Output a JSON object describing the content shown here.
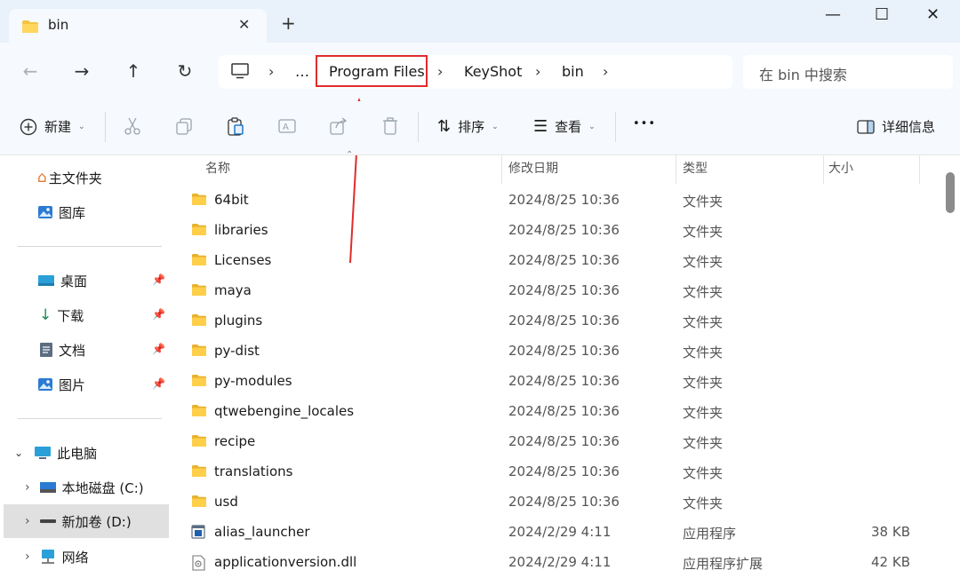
{
  "tab": {
    "title": "bin",
    "close_glyph": "✕",
    "new_tab_glyph": "+"
  },
  "window": {
    "minimize": "—",
    "maximize": "☐",
    "close": "✕"
  },
  "nav": {
    "back": "←",
    "forward": "→",
    "up": "↑",
    "refresh": "↻"
  },
  "address": {
    "crumbs": [
      "…",
      "Program Files",
      "KeyShot",
      "bin"
    ],
    "sep": "›"
  },
  "search": {
    "placeholder": "在 bin 中搜索"
  },
  "toolbar": {
    "new_label": "新建",
    "sort_label": "排序",
    "view_label": "查看",
    "more_label": "•••",
    "details_label": "详细信息"
  },
  "sidebar": {
    "home": "主文件夹",
    "gallery": "图库",
    "desktop": "桌面",
    "downloads": "下载",
    "documents": "文档",
    "pictures": "图片",
    "this_pc": "此电脑",
    "drive_c": "本地磁盘 (C:)",
    "drive_d": "新加卷 (D:)",
    "network": "网络"
  },
  "columns": {
    "name": "名称",
    "date": "修改日期",
    "type": "类型",
    "size": "大小"
  },
  "files": [
    {
      "name": "64bit",
      "date": "2024/8/25 10:36",
      "type": "文件夹",
      "size": "",
      "icon": "folder-icon"
    },
    {
      "name": "libraries",
      "date": "2024/8/25 10:36",
      "type": "文件夹",
      "size": "",
      "icon": "folder-icon"
    },
    {
      "name": "Licenses",
      "date": "2024/8/25 10:36",
      "type": "文件夹",
      "size": "",
      "icon": "folder-icon"
    },
    {
      "name": "maya",
      "date": "2024/8/25 10:36",
      "type": "文件夹",
      "size": "",
      "icon": "folder-icon"
    },
    {
      "name": "plugins",
      "date": "2024/8/25 10:36",
      "type": "文件夹",
      "size": "",
      "icon": "folder-icon"
    },
    {
      "name": "py-dist",
      "date": "2024/8/25 10:36",
      "type": "文件夹",
      "size": "",
      "icon": "folder-icon"
    },
    {
      "name": "py-modules",
      "date": "2024/8/25 10:36",
      "type": "文件夹",
      "size": "",
      "icon": "folder-icon"
    },
    {
      "name": "qtwebengine_locales",
      "date": "2024/8/25 10:36",
      "type": "文件夹",
      "size": "",
      "icon": "folder-icon"
    },
    {
      "name": "recipe",
      "date": "2024/8/25 10:36",
      "type": "文件夹",
      "size": "",
      "icon": "folder-icon"
    },
    {
      "name": "translations",
      "date": "2024/8/25 10:36",
      "type": "文件夹",
      "size": "",
      "icon": "folder-icon"
    },
    {
      "name": "usd",
      "date": "2024/8/25 10:36",
      "type": "文件夹",
      "size": "",
      "icon": "folder-icon"
    },
    {
      "name": "alias_launcher",
      "date": "2024/2/29 4:11",
      "type": "应用程序",
      "size": "38 KB",
      "icon": "app-icon"
    },
    {
      "name": "applicationversion.dll",
      "date": "2024/2/29 4:11",
      "type": "应用程序扩展",
      "size": "42 KB",
      "icon": "dll-icon"
    }
  ],
  "colors": {
    "accent": "#0067c0",
    "folder": "#f4c542",
    "highlight": "#e02c2c"
  }
}
